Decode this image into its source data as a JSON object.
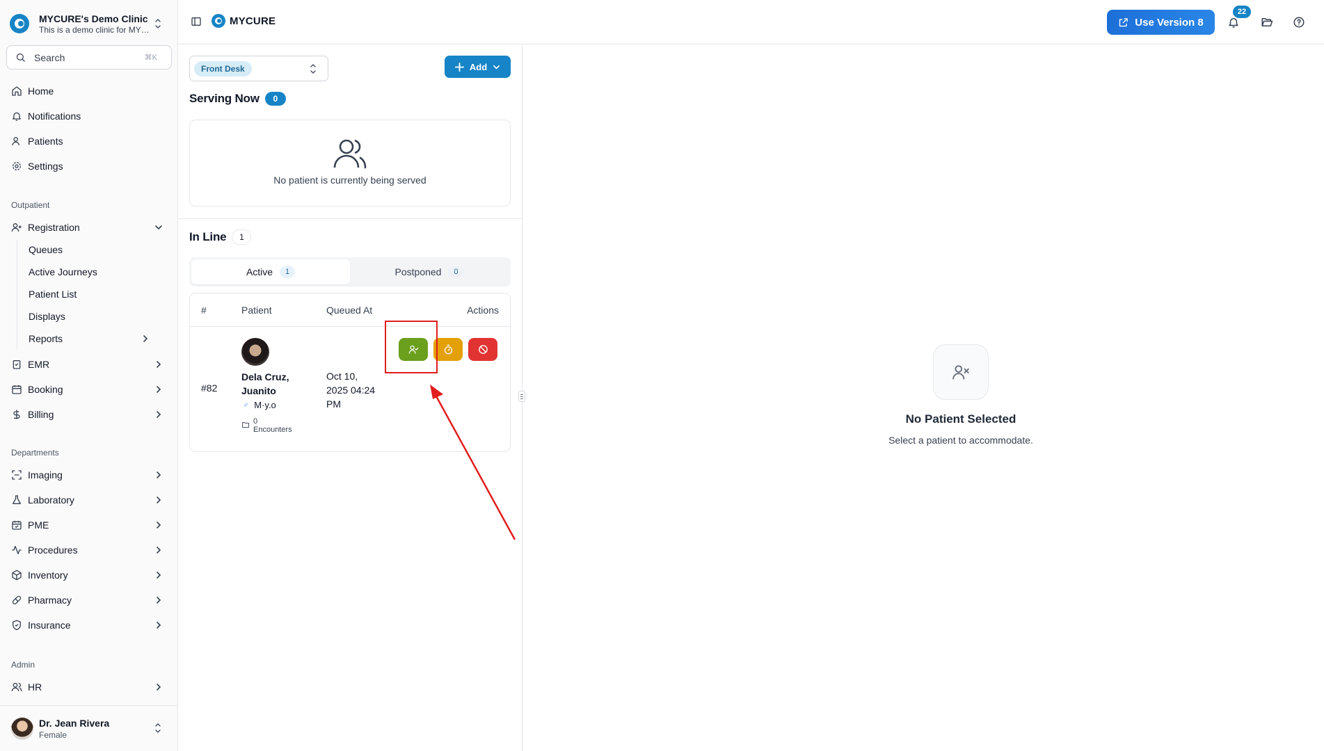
{
  "clinic": {
    "name": "MYCURE's Demo Clinic",
    "subtitle": "This is a demo clinic for MYCURE"
  },
  "search": {
    "label": "Search",
    "shortcut": "⌘K"
  },
  "nav": {
    "home": "Home",
    "notifications": "Notifications",
    "patients": "Patients",
    "settings": "Settings",
    "outpatient_title": "Outpatient",
    "registration": "Registration",
    "registration_sub": [
      "Queues",
      "Active Journeys",
      "Patient List",
      "Displays",
      "Reports"
    ],
    "emr": "EMR",
    "booking": "Booking",
    "billing": "Billing",
    "departments_title": "Departments",
    "imaging": "Imaging",
    "laboratory": "Laboratory",
    "pme": "PME",
    "procedures": "Procedures",
    "inventory": "Inventory",
    "pharmacy": "Pharmacy",
    "insurance": "Insurance",
    "admin_title": "Admin",
    "hr": "HR"
  },
  "user": {
    "name": "Dr. Jean Rivera",
    "sex": "Female"
  },
  "topbar": {
    "brand": "MYCURE",
    "version_button": "Use Version 8",
    "notification_count": "22"
  },
  "queue": {
    "station": "Front Desk",
    "add_label": "Add",
    "serving_title": "Serving Now",
    "serving_count": "0",
    "serving_empty": "No patient is currently being served",
    "inline_title": "In Line",
    "inline_count": "1",
    "tabs": [
      {
        "label": "Active",
        "count": "1"
      },
      {
        "label": "Postponed",
        "count": "0"
      }
    ],
    "columns": {
      "number": "#",
      "patient": "Patient",
      "queued_at": "Queued At",
      "actions": "Actions"
    },
    "rows": [
      {
        "number": "#82",
        "name": "Dela Cruz, Juanito",
        "sex_symbol": "♂",
        "age": "M·y.o",
        "encounters_count": "0",
        "encounters_label": "Encounters",
        "queued_at": "Oct 10, 2025 04:24 PM"
      }
    ]
  },
  "empty_state": {
    "title": "No Patient Selected",
    "subtitle": "Select a patient to accommodate."
  },
  "colors": {
    "primary": "#1684c6",
    "accommodate": "#6b9f1e",
    "postpone": "#e3a008",
    "cancel": "#e23333",
    "annotation": "#e11d1d"
  }
}
